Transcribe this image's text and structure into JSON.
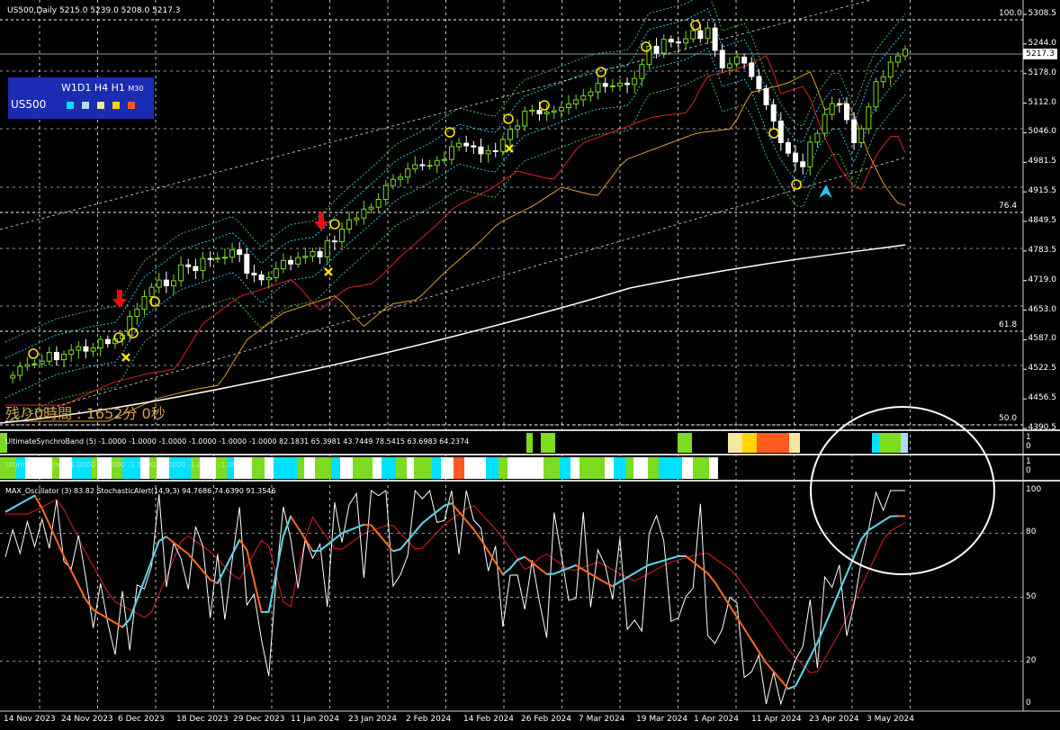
{
  "header": {
    "symbol_title": "US500,Daily  5215.0 5239.0 5208.0 5217.3"
  },
  "timeframe_panel": {
    "timeframes": "W1D1 H4 H1",
    "m30": "M30",
    "symbol": "US500",
    "colors": [
      "#00e0ff",
      "#b0d8ff",
      "#f5e6a0",
      "#ffd400",
      "#ff5a1f"
    ]
  },
  "countdown": "残り0時間 : 1652分 0秒",
  "price_axis": {
    "ticks": [
      "5308.5",
      "5244.0",
      "5178.0",
      "5112.0",
      "5046.0",
      "4981.5",
      "4915.5",
      "4849.5",
      "4783.5",
      "4719.0",
      "4653.0",
      "4587.0",
      "4522.5",
      "4456.5",
      "4390.5"
    ],
    "current_price": "5217.3",
    "fib_labels": [
      "100.0",
      "76.4",
      "61.8",
      "50.0"
    ]
  },
  "band1": {
    "label": "UltimateSynchroBand (5) -1.0000 -1.0000 -1.0000 -1.0000 -1.0000 -1.0000 82.1831 65.3981 43.7449 78.5415 63.6983 64.2374",
    "axis": [
      "1",
      "0"
    ]
  },
  "band2": {
    "label": "UltimateSynchro -1.0000 -1.0000 -1.0000 -1.0000 -1.0000 -1.0000",
    "axis": [
      "1",
      "0"
    ]
  },
  "oscillator": {
    "label": "MAX_Oscillator (3) 83.82  StochasticAlert(14,9,3) 94.7686 74.6390 91.3546",
    "axis": [
      "100",
      "80",
      "50",
      "20",
      "0"
    ]
  },
  "time_axis": [
    "14 Nov 2023",
    "24 Nov 2023",
    "6 Dec 2023",
    "18 Dec 2023",
    "29 Dec 2023",
    "11 Jan 2024",
    "23 Jan 2024",
    "2 Feb 2024",
    "14 Feb 2024",
    "26 Feb 2024",
    "7 Mar 2024",
    "19 Mar 2024",
    "1 Apr 2024",
    "11 Apr 2024",
    "23 Apr 2024",
    "3 May 2024"
  ],
  "colors": {
    "up_candle": "#7ddc1f",
    "down_candle": "#ffffff",
    "ma_red": "#e02020",
    "ma_orange": "#e0a020",
    "ma_white": "#ffffff",
    "band_cyan": "#22c8e6",
    "band_green": "#43c043",
    "osc_orange": "#ff6a1a",
    "osc_cyan": "#4fd6f0"
  }
}
